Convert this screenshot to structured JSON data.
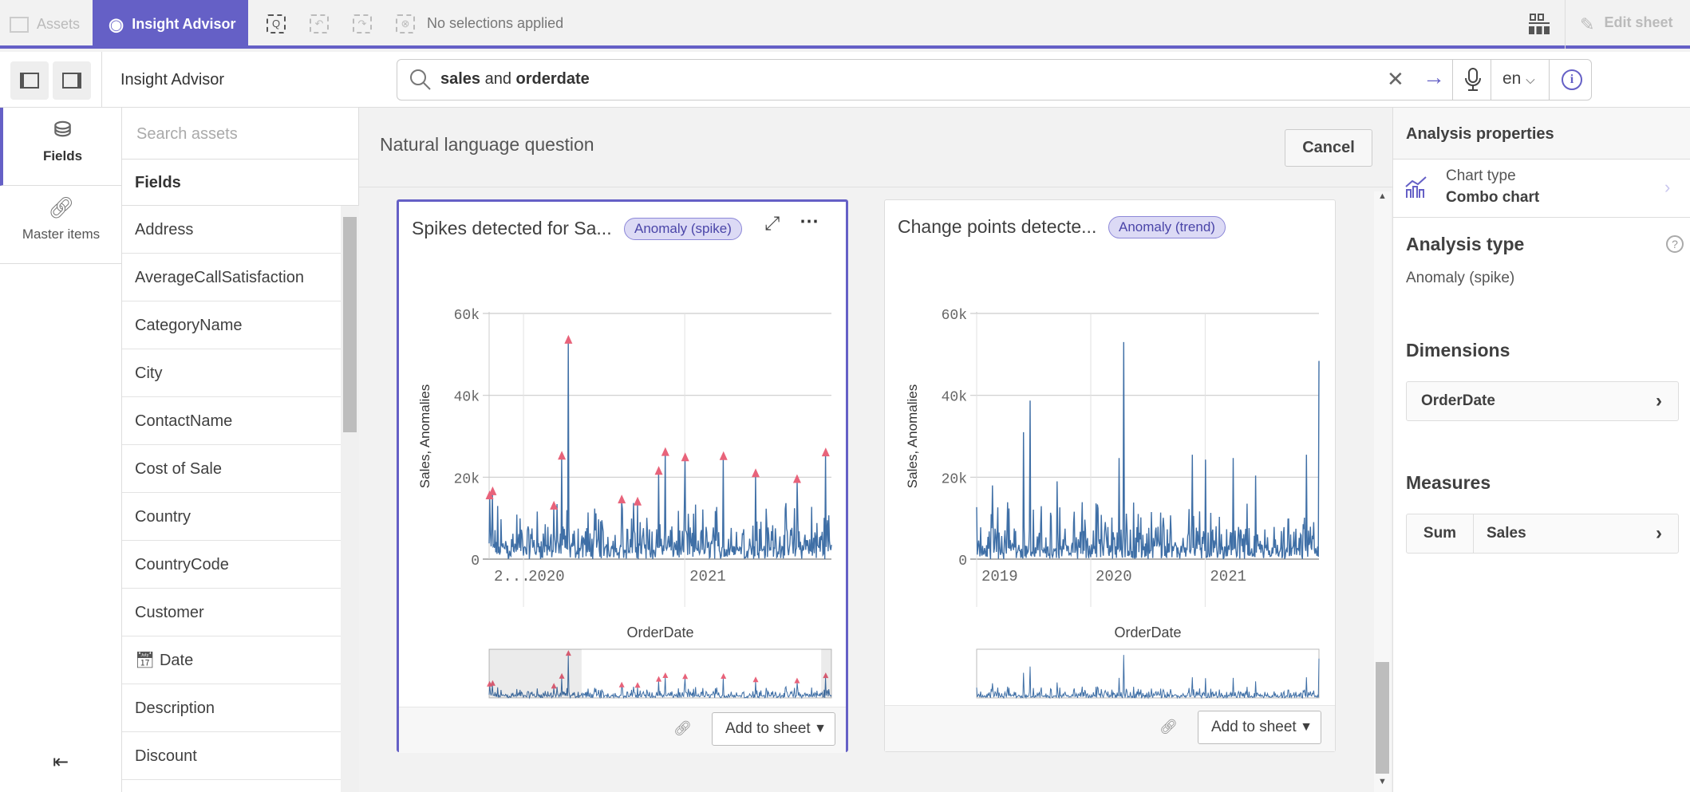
{
  "topbar": {
    "assets_label": "Assets",
    "insight_tab_label": "Insight Advisor",
    "selections_text": "No selections applied",
    "edit_sheet_label": "Edit sheet"
  },
  "toolbar": {
    "title": "Insight Advisor",
    "search_value_bold1": "sales",
    "search_value_mid": " and ",
    "search_value_bold2": "orderdate",
    "language": "en"
  },
  "rail": {
    "items": [
      {
        "label": "Fields",
        "icon": "database-icon",
        "active": true
      },
      {
        "label": "Master items",
        "icon": "link-icon",
        "active": false
      }
    ]
  },
  "fields_panel": {
    "search_placeholder": "Search assets",
    "header": "Fields",
    "items": [
      "Address",
      "AverageCallSatisfaction",
      "CategoryName",
      "City",
      "ContactName",
      "Cost of Sale",
      "Country",
      "CountryCode",
      "Customer",
      "Date",
      "Description",
      "Discount"
    ]
  },
  "main": {
    "heading": "Natural language question",
    "cancel_label": "Cancel"
  },
  "cards": [
    {
      "title": "Spikes detected for Sa...",
      "chip": "Anomaly (spike)",
      "add_label": "Add to sheet",
      "selected": true
    },
    {
      "title": "Change points detecte...",
      "chip": "Anomaly (trend)",
      "add_label": "Add to sheet",
      "selected": false
    }
  ],
  "chart_data": [
    {
      "type": "line",
      "xlabel": "OrderDate",
      "ylabel": "Sales, Anomalies",
      "ylim": [
        0,
        60000
      ],
      "ytick_labels": [
        "0",
        "20k",
        "40k",
        "60k"
      ],
      "yticks": [
        0,
        20000,
        40000,
        60000
      ],
      "x_range": [
        "2019-10-15",
        "2021-11-30"
      ],
      "xticks": [
        {
          "date": "2020-01-01",
          "label": "2020"
        },
        {
          "date": "2021-01-01",
          "label": "2021"
        }
      ],
      "xtick_left_label": "2...",
      "line_color": "#3f6fa6",
      "anomaly_color": "#e8637a",
      "grid": true,
      "anomalies": [
        {
          "date": "2019-10-16",
          "value": 15000
        },
        {
          "date": "2019-10-23",
          "value": 16000
        },
        {
          "date": "2020-03-10",
          "value": 12500
        },
        {
          "date": "2020-03-28",
          "value": 24700
        },
        {
          "date": "2020-04-12",
          "value": 53000
        },
        {
          "date": "2020-08-11",
          "value": 14000
        },
        {
          "date": "2020-09-16",
          "value": 13500
        },
        {
          "date": "2020-11-03",
          "value": 21000
        },
        {
          "date": "2020-11-18",
          "value": 25600
        },
        {
          "date": "2021-01-02",
          "value": 24300
        },
        {
          "date": "2021-03-30",
          "value": 24600
        },
        {
          "date": "2021-06-11",
          "value": 20400
        },
        {
          "date": "2021-09-13",
          "value": 19000
        },
        {
          "date": "2021-11-17",
          "value": 25500
        }
      ],
      "peaks": []
    },
    {
      "type": "line",
      "xlabel": "OrderDate",
      "ylabel": "Sales, Anomalies",
      "ylim": [
        0,
        60000
      ],
      "ytick_labels": [
        "0",
        "20k",
        "40k",
        "60k"
      ],
      "yticks": [
        0,
        20000,
        40000,
        60000
      ],
      "x_range": [
        "2019-01-01",
        "2021-12-31"
      ],
      "xticks": [
        {
          "date": "2019-01-01",
          "label": "2019"
        },
        {
          "date": "2020-01-01",
          "label": "2020"
        },
        {
          "date": "2021-01-01",
          "label": "2021"
        }
      ],
      "line_color": "#3f6fa6",
      "grid": true,
      "anomalies": [],
      "peaks": [
        {
          "date": "2019-02-20",
          "value": 18000
        },
        {
          "date": "2019-05-30",
          "value": 31000
        },
        {
          "date": "2019-06-20",
          "value": 38700
        },
        {
          "date": "2019-09-16",
          "value": 19000
        },
        {
          "date": "2020-04-01",
          "value": 24700
        },
        {
          "date": "2020-04-15",
          "value": 53000
        },
        {
          "date": "2020-11-21",
          "value": 25500
        },
        {
          "date": "2021-01-02",
          "value": 24300
        },
        {
          "date": "2021-04-01",
          "value": 24700
        },
        {
          "date": "2021-06-11",
          "value": 20400
        },
        {
          "date": "2021-11-20",
          "value": 25500
        },
        {
          "date": "2021-12-30",
          "value": 48400
        }
      ]
    }
  ],
  "properties": {
    "header": "Analysis properties",
    "chart_type_label": "Chart type",
    "chart_type_value": "Combo chart",
    "analysis_type_heading": "Analysis type",
    "analysis_type_value": "Anomaly (spike)",
    "dimensions_heading": "Dimensions",
    "dimension": "OrderDate",
    "measures_heading": "Measures",
    "measure_agg": "Sum",
    "measure_field": "Sales"
  },
  "colors": {
    "accent": "#6560c6",
    "line": "#3f6fa6",
    "anomaly": "#e8637a"
  }
}
